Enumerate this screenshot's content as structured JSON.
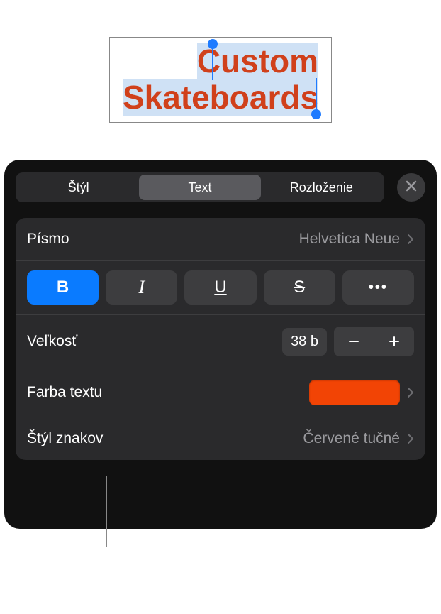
{
  "canvas": {
    "text_line1": "Custom",
    "text_line2": "Skateboards",
    "text_color": "#d0401b",
    "selection_bg": "#cfe1f5"
  },
  "tabs": {
    "items": [
      "Štýl",
      "Text",
      "Rozloženie"
    ],
    "active_index": 1
  },
  "font_row": {
    "label": "Písmo",
    "value": "Helvetica Neue"
  },
  "styles": {
    "bold": "B",
    "italic": "I",
    "underline": "U",
    "strike": "S",
    "more": "•••",
    "bold_active": true
  },
  "size_row": {
    "label": "Veľkosť",
    "value": "38 b"
  },
  "color_row": {
    "label": "Farba textu",
    "swatch": "#f24405"
  },
  "charstyle_row": {
    "label": "Štýl znakov",
    "value": "Červené tučné"
  }
}
